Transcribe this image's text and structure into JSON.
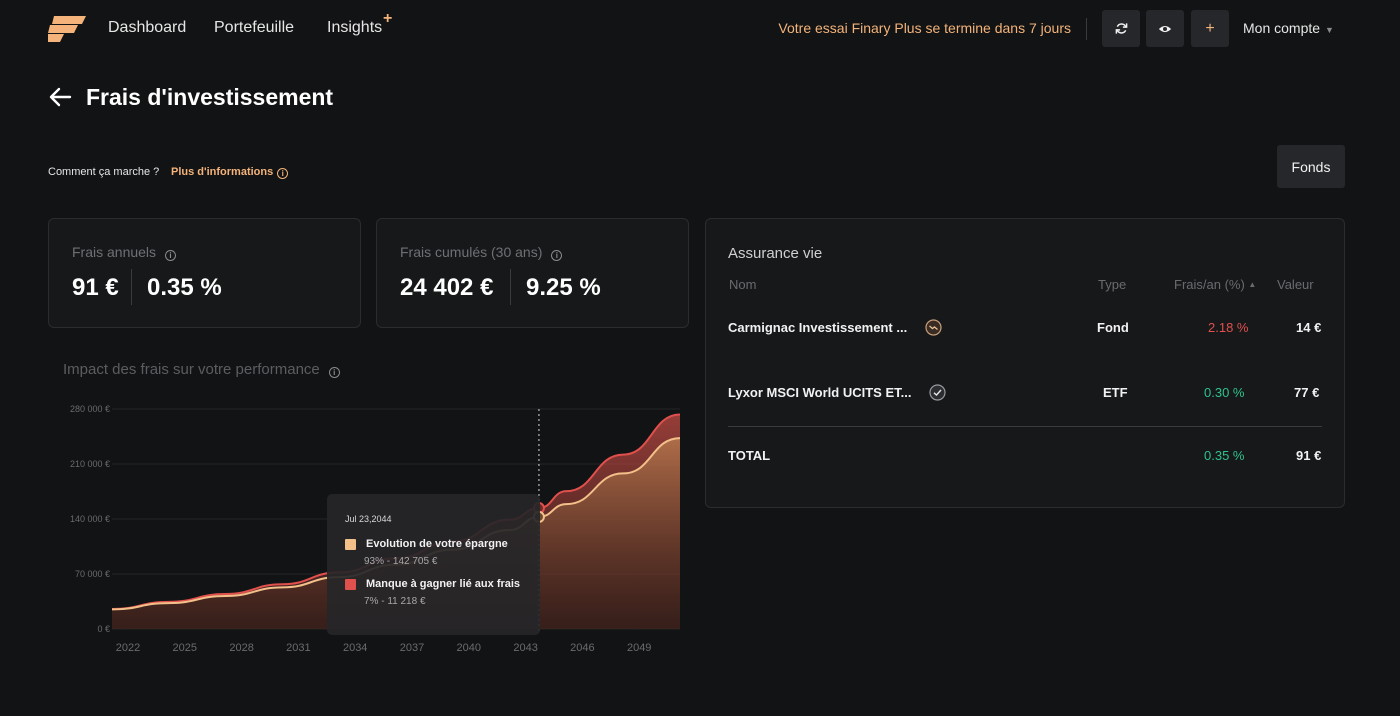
{
  "nav": {
    "links": [
      "Dashboard",
      "Portefeuille",
      "Insights"
    ],
    "insights_badge": "+",
    "trial_text": "Votre essai Finary Plus se termine dans 7 jours",
    "buttons": [
      "refresh-icon",
      "eye-icon",
      "plus-icon"
    ],
    "add_label": "+",
    "account_label": "Mon compte"
  },
  "page": {
    "title": "Frais d'investissement",
    "how_label": "Comment ça marche ?",
    "more_info_label": "Plus d'informations",
    "fonds_button": "Fonds"
  },
  "cards": [
    {
      "label": "Frais annuels",
      "value": "91 €",
      "percent": "0.35 %"
    },
    {
      "label": "Frais cumulés (30 ans)",
      "value": "24 402 €",
      "percent": "9.25 %"
    }
  ],
  "chart_data": {
    "type": "area",
    "title": "Impact des frais sur votre performance",
    "y_ticks": [
      "280 000 €",
      "210 000 €",
      "140 000 €",
      "70 000 €",
      "0 €"
    ],
    "x_ticks": [
      "2022",
      "2025",
      "2028",
      "2031",
      "2034",
      "2037",
      "2040",
      "2043",
      "2046",
      "2049"
    ],
    "ylim": [
      0,
      280000
    ],
    "x": [
      2022,
      2025,
      2028,
      2031,
      2034,
      2037,
      2040,
      2043,
      2044.55,
      2046,
      2049,
      2052
    ],
    "series": [
      {
        "name": "Evolution de votre épargne",
        "color": "#f3c08a",
        "values": [
          25000,
          33000,
          42000,
          53000,
          66000,
          82000,
          101000,
          126000,
          142705,
          159000,
          198000,
          243000
        ]
      },
      {
        "name": "Manque à gagner lié aux frais",
        "color": "#e0504d",
        "values": [
          25500,
          34500,
          44500,
          57000,
          72000,
          90000,
          111500,
          139000,
          153923,
          175500,
          222000,
          273000
        ]
      }
    ],
    "tooltip": {
      "date": "Jul 23,2044",
      "items": [
        {
          "label": "Evolution de votre épargne",
          "sub": "93% - 142 705 €",
          "color": "#f3c08a"
        },
        {
          "label": "Manque à gagner lié aux frais",
          "sub": "7% - 11 218 €",
          "color": "#e0504d"
        }
      ]
    }
  },
  "table": {
    "title": "Assurance vie",
    "headers": {
      "name": "Nom",
      "type": "Type",
      "fees": "Frais/an (%)",
      "sort_icon": "▲",
      "value": "Valeur"
    },
    "rows": [
      {
        "name": "Carmignac Investissement ...",
        "icon": "trend-down-icon",
        "type": "Fond",
        "fees": "2.18 %",
        "value": "14 €"
      },
      {
        "name": "Lyxor MSCI World UCITS ET...",
        "icon": "check-circle-icon",
        "type": "ETF",
        "fees": "0.30 %",
        "value": "77 €"
      }
    ],
    "total": {
      "label": "TOTAL",
      "fees": "0.35 %",
      "value": "91 €"
    }
  }
}
